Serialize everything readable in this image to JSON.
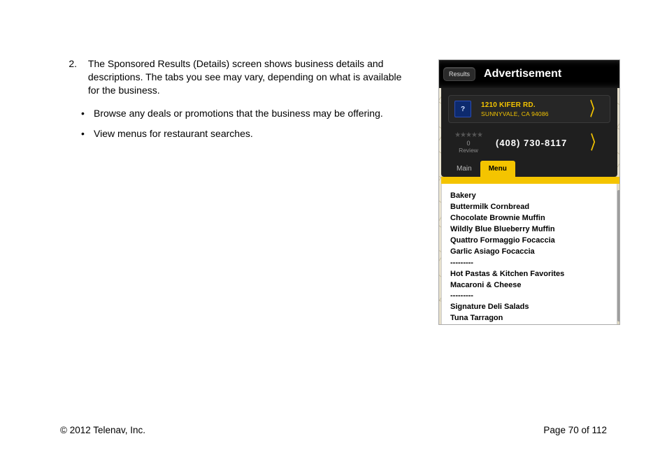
{
  "list": {
    "number": "2.",
    "paragraph": "The Sponsored Results (Details) screen shows business details and descriptions. The tabs you see may vary, depending on what is available for the business.",
    "bullets": [
      "Browse any deals or promotions that the business may be offering.",
      "View menus for restaurant searches."
    ]
  },
  "phone": {
    "results_label": "Results",
    "title": "Advertisement",
    "square_icon_mark": "?",
    "address_line1": "1210 KIFER RD.",
    "address_line2": "SUNNYVALE, CA 94086",
    "stars": "★★★★★",
    "review_count": "0",
    "review_label": "Review",
    "phone_number": "(408) 730-8117",
    "tabs": {
      "main": "Main",
      "menu": "Menu"
    },
    "menu_items": [
      "Bakery",
      "Buttermilk Cornbread",
      "Chocolate Brownie Muffin",
      "Wildly Blue Blueberry Muffin",
      "Quattro Formaggio Focaccia",
      "Garlic Asiago Focaccia",
      "---------",
      "Hot Pastas & Kitchen Favorites",
      "Macaroni & Cheese",
      "---------",
      "Signature Deli Salads",
      "Tuna Tarragon"
    ]
  },
  "footer": {
    "copyright": "© 2012 Telenav, Inc.",
    "page": "Page 70 of 112"
  }
}
